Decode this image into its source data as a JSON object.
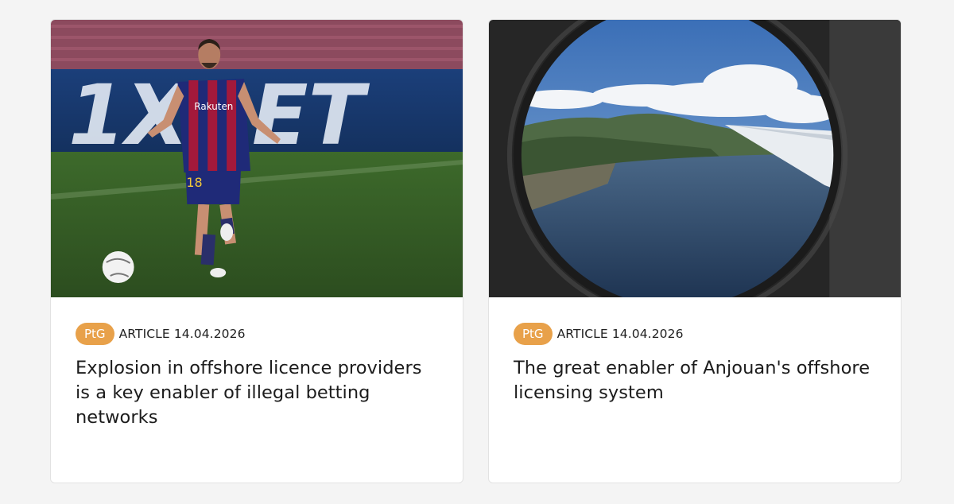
{
  "cards": [
    {
      "image_alt": "Footballer in Barcelona kit in front of 1XBET advertising board",
      "image_board_text": "1XBET",
      "image_shirt_text": "Rakuten",
      "image_number": "18",
      "badge": "PtG",
      "type": "ARTICLE",
      "date": "14.04.2026",
      "title": "Explosion in offshore licence providers is a key enabler of illegal betting networks"
    },
    {
      "image_alt": "Aerial view through an airplane window of a green island coastline and sea",
      "badge": "PtG",
      "type": "ARTICLE",
      "date": "14.04.2026",
      "title": "The great enabler of Anjouan's offshore licensing system"
    }
  ],
  "colors": {
    "badge_bg": "#e8a14a",
    "page_bg": "#f4f4f4",
    "card_bg": "#ffffff"
  }
}
